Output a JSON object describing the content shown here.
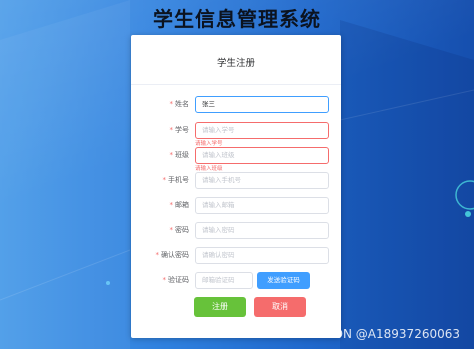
{
  "app_title": "学生信息管理系统",
  "card": {
    "title": "学生注册",
    "fields": [
      {
        "label": "姓名",
        "value": "张三",
        "placeholder": "",
        "error": ""
      },
      {
        "label": "学号",
        "value": "",
        "placeholder": "请输入学号",
        "error": "请输入学号"
      },
      {
        "label": "班级",
        "value": "",
        "placeholder": "请输入班级",
        "error": "请输入班级"
      },
      {
        "label": "手机号",
        "value": "",
        "placeholder": "请输入手机号",
        "error": ""
      },
      {
        "label": "邮箱",
        "value": "",
        "placeholder": "请输入邮箱",
        "error": ""
      },
      {
        "label": "密码",
        "value": "",
        "placeholder": "请输入密码",
        "error": ""
      },
      {
        "label": "确认密码",
        "value": "",
        "placeholder": "请确认密码",
        "error": ""
      },
      {
        "label": "验证码",
        "value": "",
        "placeholder": "邮箱验证码",
        "error": ""
      }
    ],
    "required_mark": "*",
    "send_code_label": "发送验证码",
    "submit_label": "注册",
    "cancel_label": "取消"
  },
  "watermark": "CSDN @A18937260063",
  "colors": {
    "primary": "#409eff",
    "success": "#67c23a",
    "danger": "#f56c6c",
    "background": "#1f6fd1"
  }
}
